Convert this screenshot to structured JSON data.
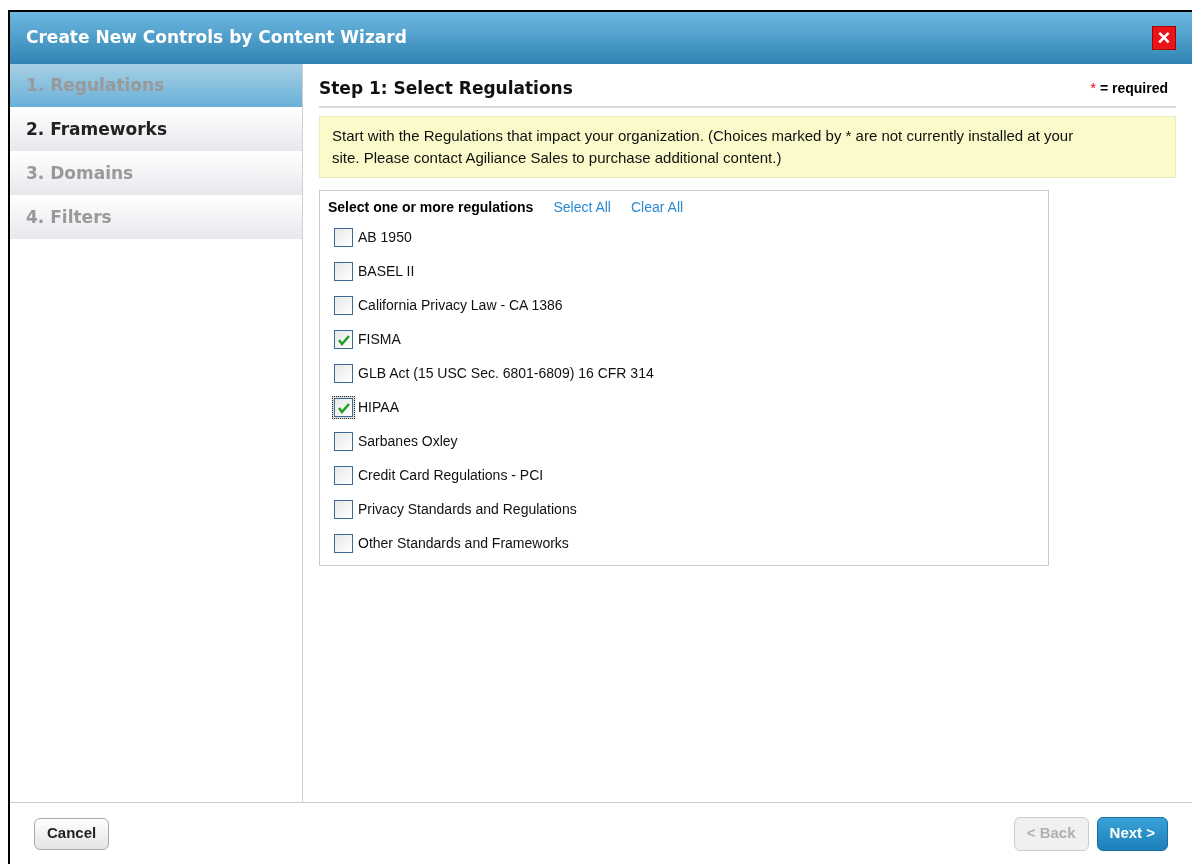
{
  "window": {
    "title": "Create New Controls by Content Wizard",
    "close": "×"
  },
  "steps": [
    {
      "label": "1. Regulations",
      "selected": true,
      "disabled": false
    },
    {
      "label": "2. Frameworks",
      "selected": false,
      "disabled": false
    },
    {
      "label": "3. Domains",
      "selected": false,
      "disabled": true
    },
    {
      "label": "4. Filters",
      "selected": false,
      "disabled": true
    }
  ],
  "heading": "Step 1: Select Regulations",
  "required_mark": "*",
  "required_note": "= required",
  "notice": "Start with the Regulations that impact your organization. (Choices marked by * are not currently installed at your site. Please contact Agiliance Sales to purchase additional content.)",
  "list": {
    "label": "Select one or more regulations",
    "select_all": "Select All",
    "clear_all": "Clear All",
    "items": [
      {
        "label": "AB 1950",
        "checked": false,
        "focused": false
      },
      {
        "label": "BASEL II",
        "checked": false,
        "focused": false
      },
      {
        "label": "California Privacy Law - CA 1386",
        "checked": false,
        "focused": false
      },
      {
        "label": "FISMA",
        "checked": true,
        "focused": false
      },
      {
        "label": "GLB Act (15 USC Sec. 6801-6809) 16 CFR 314",
        "checked": false,
        "focused": false
      },
      {
        "label": "HIPAA",
        "checked": true,
        "focused": true
      },
      {
        "label": "Sarbanes Oxley",
        "checked": false,
        "focused": false
      },
      {
        "label": "Credit Card Regulations - PCI",
        "checked": false,
        "focused": false
      },
      {
        "label": "Privacy Standards and Regulations",
        "checked": false,
        "focused": false
      },
      {
        "label": "Other Standards and Frameworks",
        "checked": false,
        "focused": false
      }
    ]
  },
  "buttons": {
    "cancel": "Cancel",
    "back": {
      "label": "< Back",
      "disabled": true
    },
    "next": {
      "label": "Next >",
      "disabled": false
    }
  }
}
